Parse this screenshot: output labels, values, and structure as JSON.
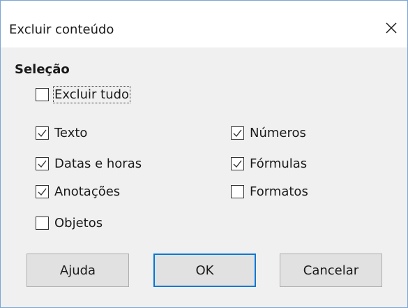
{
  "dialog": {
    "title": "Excluir conteúdo",
    "close_icon": "close-icon"
  },
  "selection": {
    "heading": "Seleção",
    "delete_all": {
      "label": "Excluir tudo",
      "checked": false
    },
    "left": [
      {
        "label": "Texto",
        "checked": true
      },
      {
        "label": "Datas e horas",
        "checked": true
      },
      {
        "label": "Anotações",
        "checked": true
      },
      {
        "label": "Objetos",
        "checked": false
      }
    ],
    "right": [
      {
        "label": "Números",
        "checked": true
      },
      {
        "label": "Fórmulas",
        "checked": true
      },
      {
        "label": "Formatos",
        "checked": false
      }
    ]
  },
  "buttons": {
    "help": "Ajuda",
    "ok": "OK",
    "cancel": "Cancelar"
  }
}
